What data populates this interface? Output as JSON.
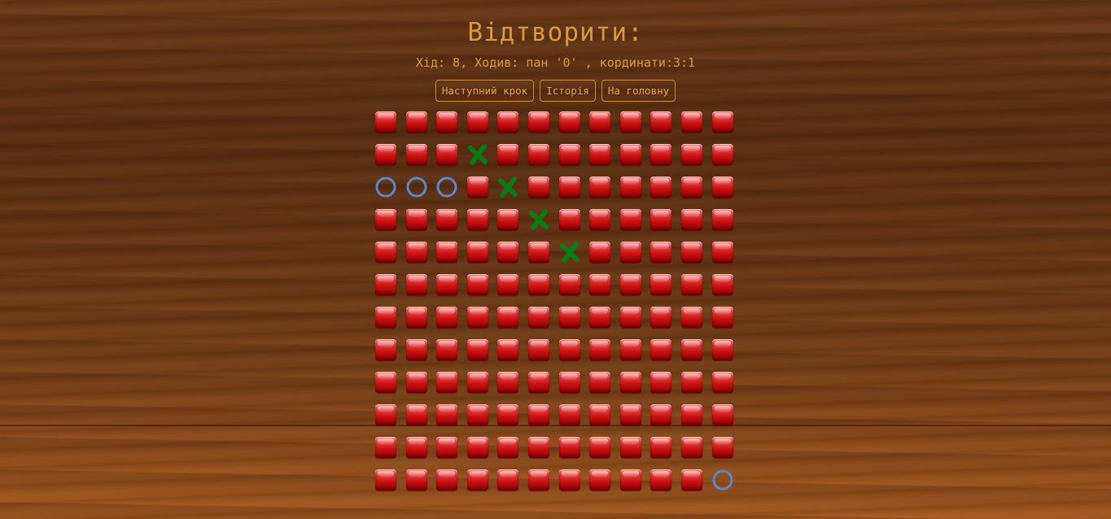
{
  "title": "Відтворити:",
  "status": "Хід: 8, Ходив: пан '0' , кординати:3:1",
  "buttons": {
    "next": "Наступний крок",
    "history": "Історія",
    "home": "На головну"
  },
  "colors": {
    "accent": "#d89a3c",
    "x_mark": "#0a7a14",
    "o_mark": "#5a87c8",
    "empty_cell": "#d01818"
  },
  "board": {
    "rows": 12,
    "cols": 12,
    "cells": [
      [
        "",
        "",
        "",
        "",
        "",
        "",
        "",
        "",
        "",
        "",
        "",
        ""
      ],
      [
        "",
        "",
        "",
        "X",
        "",
        "",
        "",
        "",
        "",
        "",
        "",
        ""
      ],
      [
        "O",
        "O",
        "O",
        "",
        "X",
        "",
        "",
        "",
        "",
        "",
        "",
        ""
      ],
      [
        "",
        "",
        "",
        "",
        "",
        "X",
        "",
        "",
        "",
        "",
        "",
        ""
      ],
      [
        "",
        "",
        "",
        "",
        "",
        "",
        "X",
        "",
        "",
        "",
        "",
        ""
      ],
      [
        "",
        "",
        "",
        "",
        "",
        "",
        "",
        "",
        "",
        "",
        "",
        ""
      ],
      [
        "",
        "",
        "",
        "",
        "",
        "",
        "",
        "",
        "",
        "",
        "",
        ""
      ],
      [
        "",
        "",
        "",
        "",
        "",
        "",
        "",
        "",
        "",
        "",
        "",
        ""
      ],
      [
        "",
        "",
        "",
        "",
        "",
        "",
        "",
        "",
        "",
        "",
        "",
        ""
      ],
      [
        "",
        "",
        "",
        "",
        "",
        "",
        "",
        "",
        "",
        "",
        "",
        ""
      ],
      [
        "",
        "",
        "",
        "",
        "",
        "",
        "",
        "",
        "",
        "",
        "",
        ""
      ],
      [
        "",
        "",
        "",
        "",
        "",
        "",
        "",
        "",
        "",
        "",
        "",
        "O"
      ]
    ]
  }
}
